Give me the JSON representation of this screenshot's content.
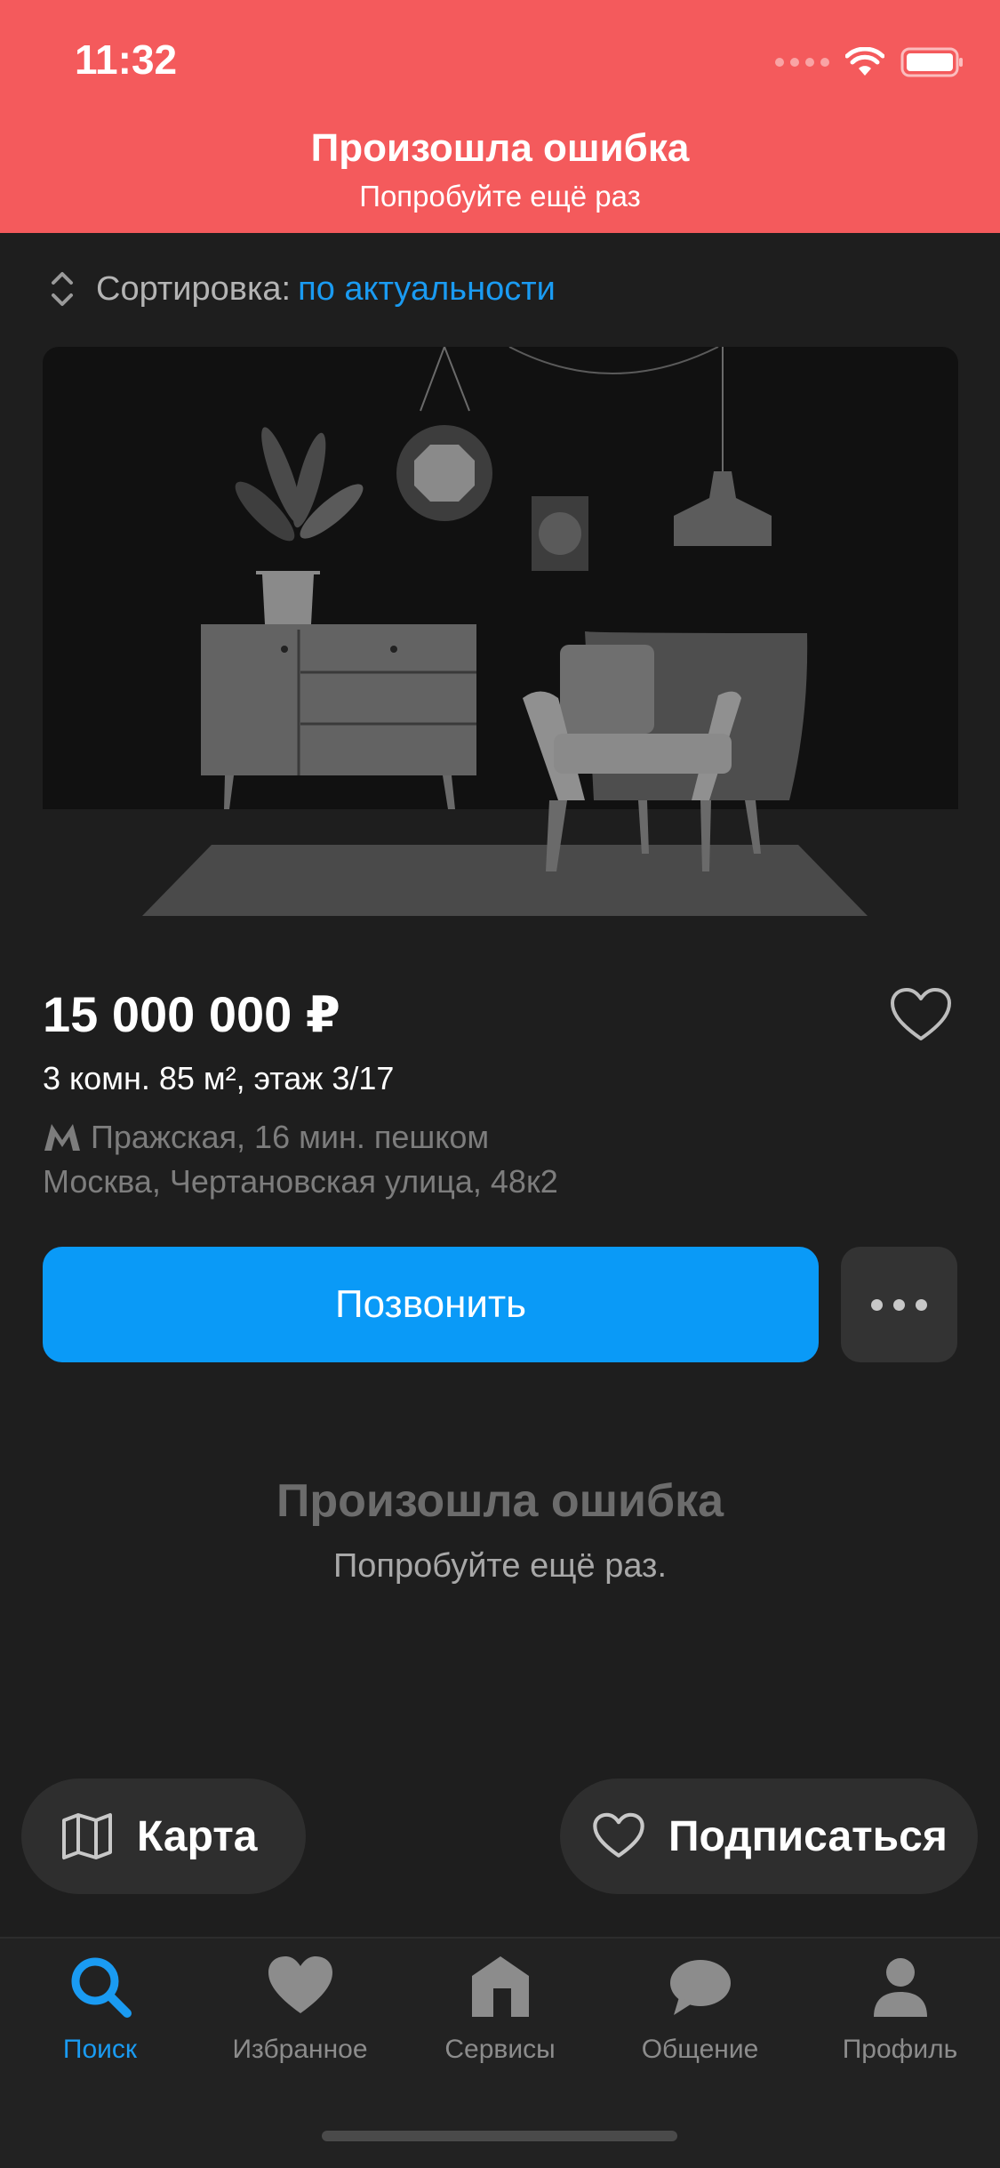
{
  "status_bar": {
    "time": "11:32"
  },
  "banner": {
    "title": "Произошла ошибка",
    "subtitle": "Попробуйте ещё раз"
  },
  "sort": {
    "label": "Сортировка:",
    "value": "по актуальности"
  },
  "listing": {
    "price": "15 000 000 ₽",
    "details": "3 комн. 85 м², этаж 3/17",
    "metro": "Пражская, 16 мин. пешком",
    "address": "Москва, Чертановская улица, 48к2",
    "call_label": "Позвонить"
  },
  "error": {
    "title": "Произошла ошибка",
    "subtitle": "Попробуйте ещё раз."
  },
  "floating": {
    "map_label": "Карта",
    "subscribe_label": "Подписаться"
  },
  "tabs": [
    {
      "label": "Поиск",
      "icon": "search-icon",
      "active": true
    },
    {
      "label": "Избранное",
      "icon": "heart-icon",
      "active": false
    },
    {
      "label": "Сервисы",
      "icon": "services-icon",
      "active": false
    },
    {
      "label": "Общение",
      "icon": "chat-icon",
      "active": false
    },
    {
      "label": "Профиль",
      "icon": "profile-icon",
      "active": false
    }
  ],
  "colors": {
    "error_banner": "#f45a5c",
    "accent": "#0a9af7",
    "background": "#1e1e1e"
  }
}
